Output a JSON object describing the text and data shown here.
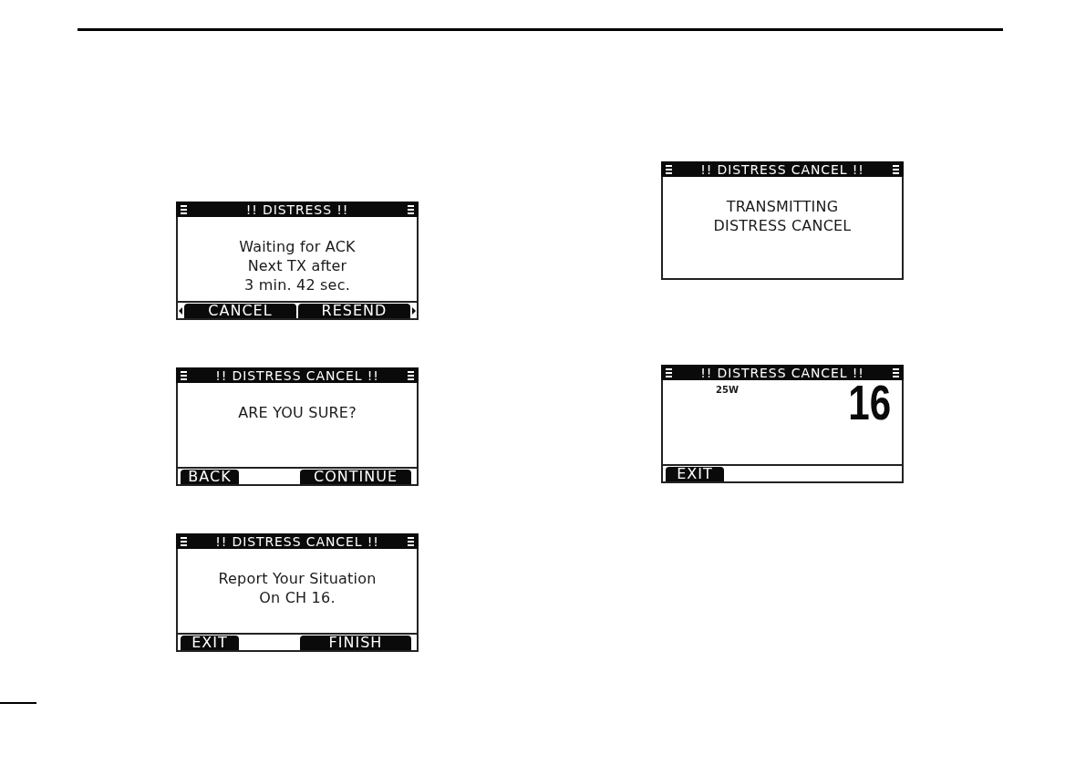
{
  "columns": [
    {
      "screens": [
        {
          "kind": "message",
          "title": "!! DISTRESS !!",
          "lines": [
            "Waiting for ACK",
            "Next TX after",
            "3 min. 42 sec."
          ],
          "scroll_arrows": true,
          "softkeys": [
            "CANCEL",
            "RESEND"
          ]
        },
        {
          "kind": "message",
          "title": "!! DISTRESS CANCEL !!",
          "lines": [
            "ARE YOU SURE?"
          ],
          "scroll_arrows": false,
          "softkeys": [
            "BACK",
            "CONTINUE"
          ]
        },
        {
          "kind": "message",
          "title": "!! DISTRESS CANCEL !!",
          "lines": [
            "Report Your Situation",
            "On CH 16."
          ],
          "scroll_arrows": false,
          "softkeys": [
            "EXIT",
            "FINISH"
          ]
        }
      ]
    },
    {
      "screens": [
        {
          "kind": "message",
          "title": "!! DISTRESS CANCEL !!",
          "lines": [
            "TRANSMITTING",
            "DISTRESS CANCEL"
          ]
        },
        {
          "kind": "channel",
          "title": "!! DISTRESS CANCEL !!",
          "power": "25W",
          "channel": "16",
          "scroll_arrows": false,
          "softkeys": [
            "EXIT"
          ]
        }
      ]
    }
  ]
}
